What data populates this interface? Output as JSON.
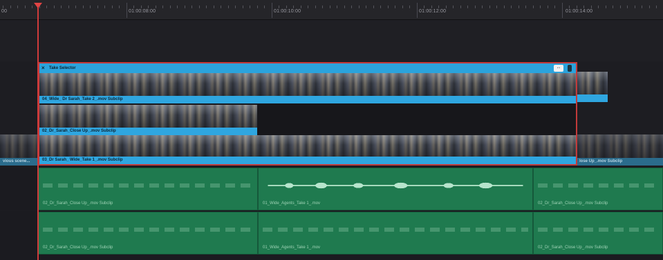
{
  "ruler": {
    "labels": [
      "00",
      "01:00:08:00",
      "01:00:10:00",
      "01:00:12:00",
      "01:00:14:00"
    ]
  },
  "take_selector": {
    "title": "Take Selector",
    "close_glyph": "×",
    "swap_glyph": "⇔",
    "takes": [
      {
        "label": "04_Wide_ Dr Sarah_Take 2_.mov Subclip"
      },
      {
        "label": "02_Dr_Sarah_Close Up_.mov Subclip"
      },
      {
        "label": "03_Dr Sarah_ Wide_Take 1_.mov Subclip"
      }
    ]
  },
  "v1": {
    "left_clip_label": "vious scene...",
    "right_clip_label": "lose Up_.mov Subclip"
  },
  "audio": {
    "a1": [
      "02_Dr_Sarah_Close Up_.mov Subclip",
      "01_Wide_Agents_Take 1_.mov",
      "02_Dr_Sarah_Close Up_.mov Subclip"
    ],
    "a2": [
      "02_Dr_Sarah_Close Up_.mov Subclip",
      "01_Wide_Agents_Take 1_.mov",
      "02_Dr_Sarah_Close Up_.mov Subclip"
    ]
  },
  "colors": {
    "playhead": "#d03b3b",
    "video_clip": "#2fa6e0",
    "audio_clip": "#1f7a4f",
    "take_selector_border": "#c23a3a"
  }
}
